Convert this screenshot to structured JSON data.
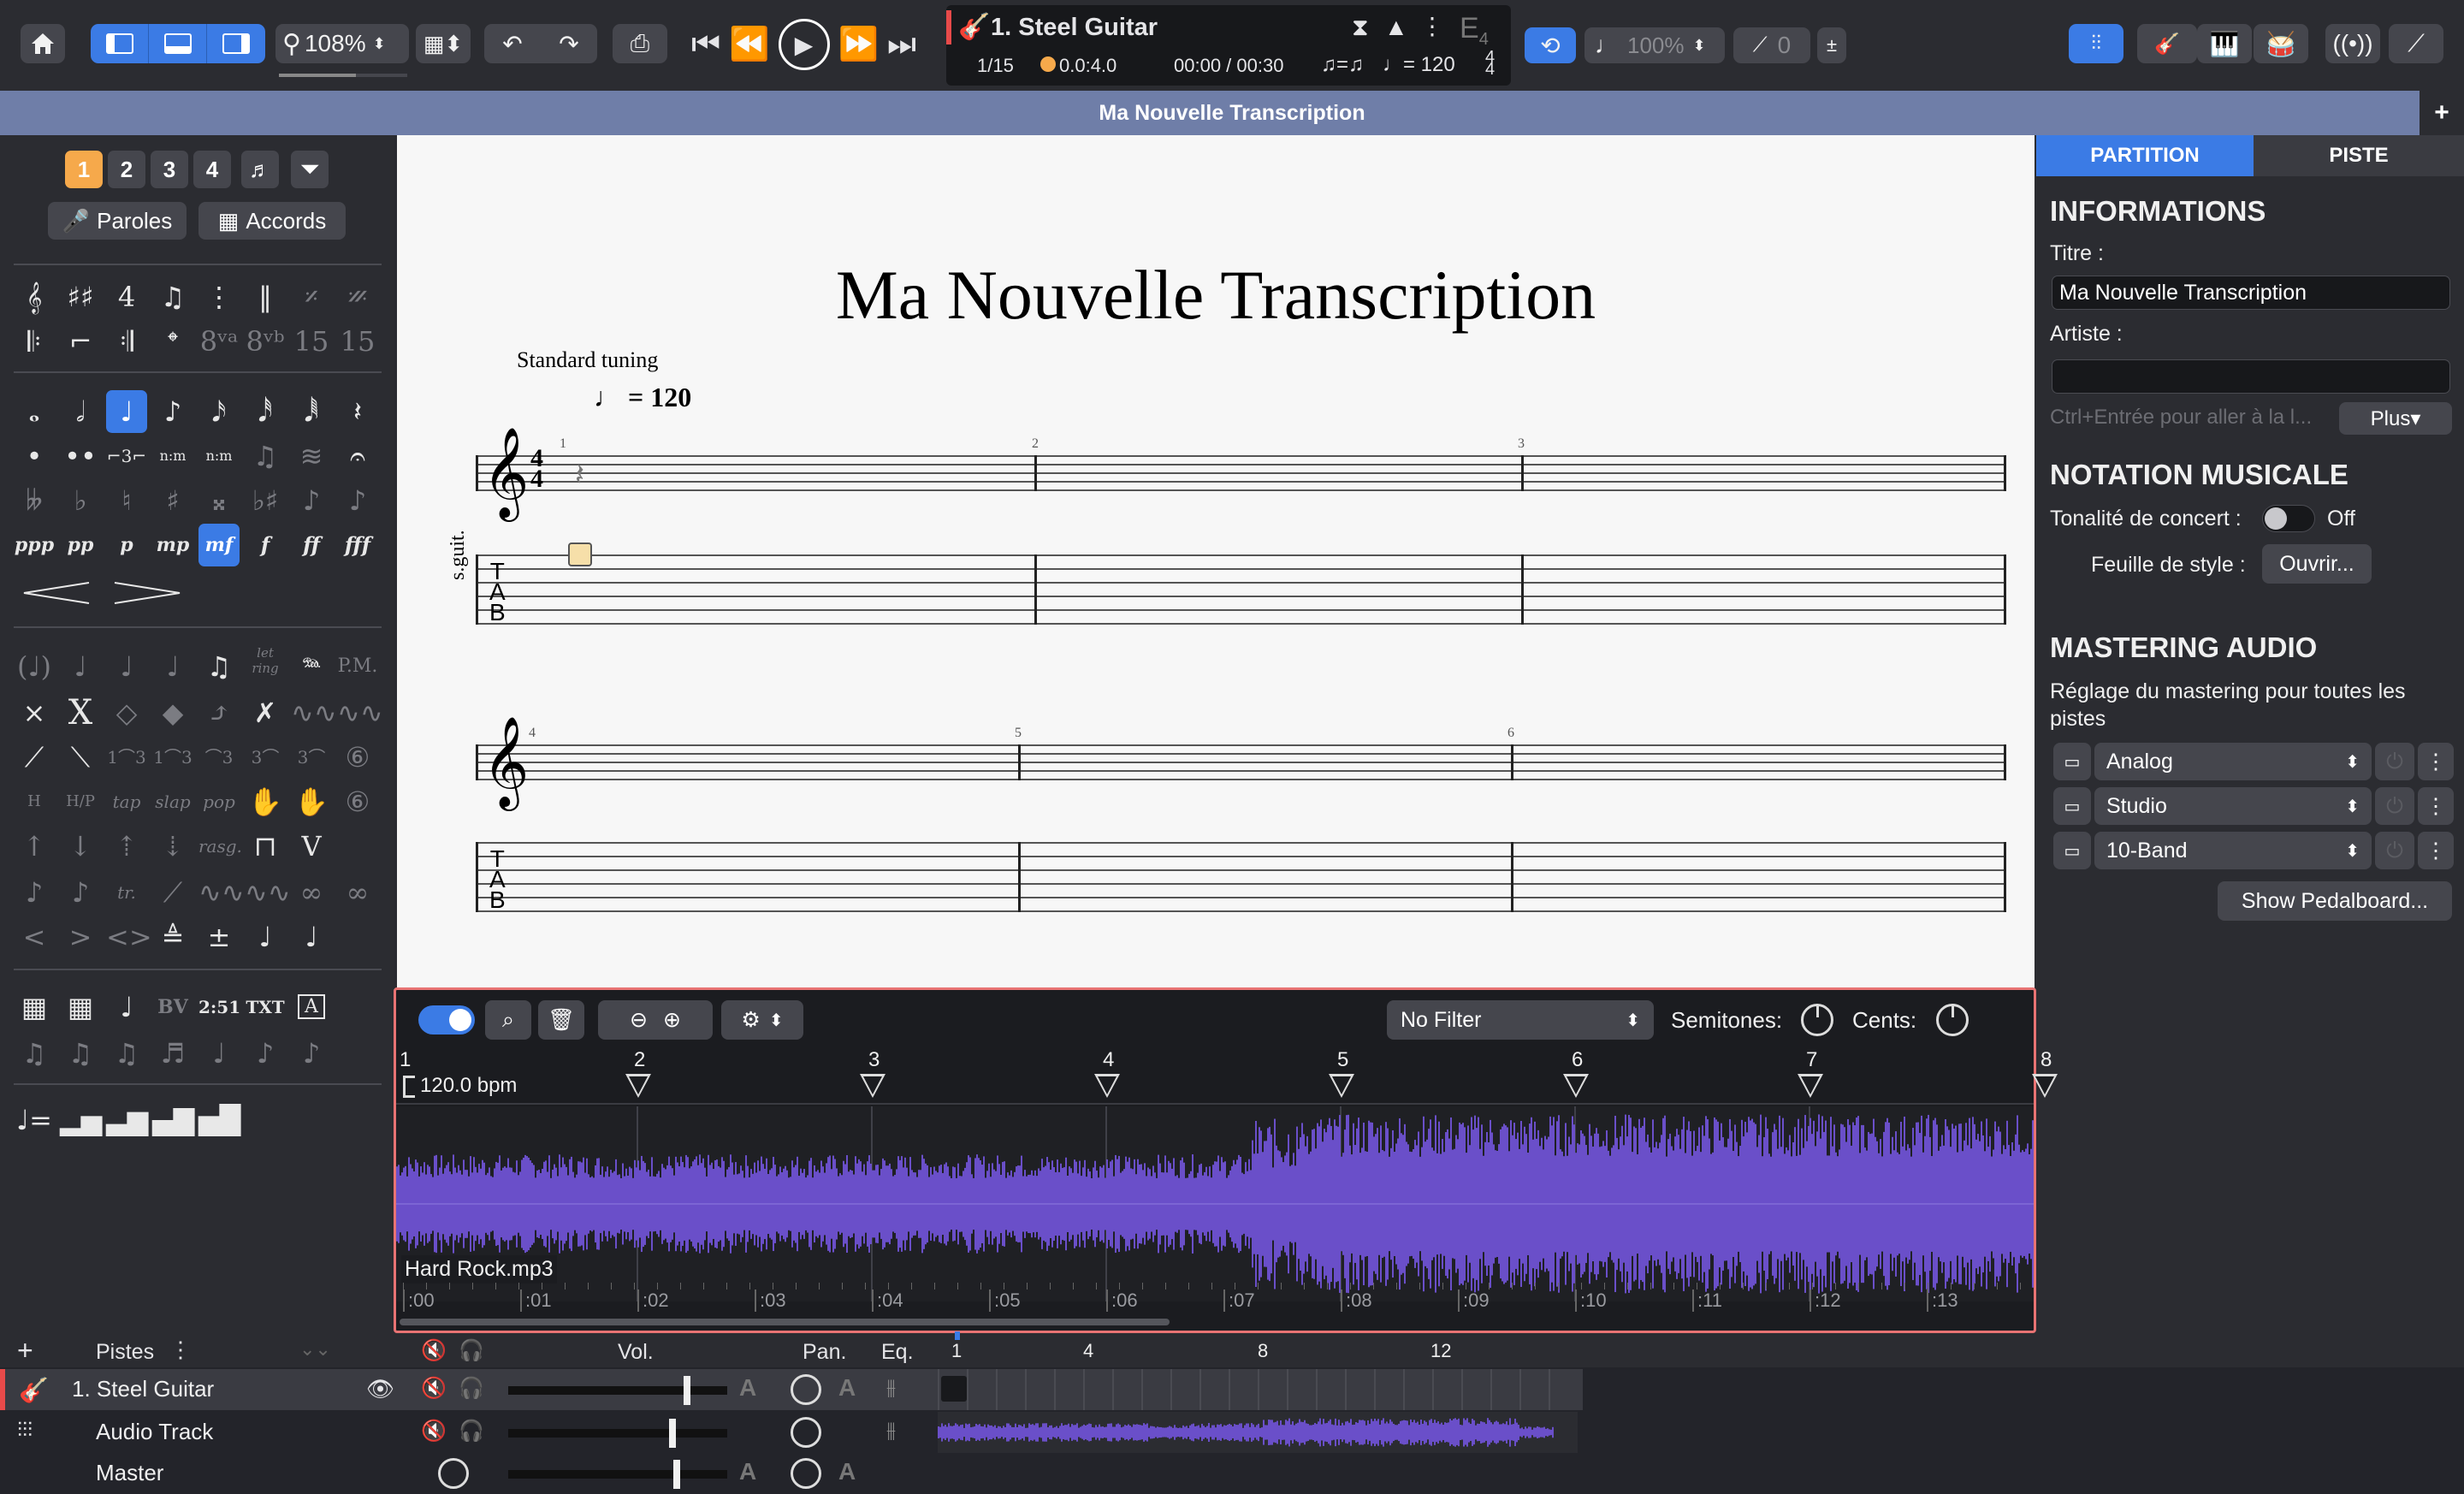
{
  "toolbar": {
    "zoom": "108%",
    "track_title": "1. Steel Guitar",
    "tuning_note": "E",
    "tuning_octave": "4",
    "bar_position": "1/15",
    "beat_position": "0.0:4.0",
    "time": "00:00 / 00:30",
    "swing_glyph": "♫=♫",
    "tempo": "♩= 120",
    "speed": "100%",
    "count": "0"
  },
  "document_title": "Ma Nouvelle Transcription",
  "left_panel": {
    "voices": [
      "1",
      "2",
      "3",
      "4"
    ],
    "lyrics_label": "Paroles",
    "chords_label": "Accords",
    "dynamics": [
      "ppp",
      "pp",
      "p",
      "mp",
      "mf",
      "f",
      "ff",
      "fff"
    ],
    "misc_labels": {
      "let_ring": "let ring",
      "pm": "P.M.",
      "tap": "tap",
      "slap": "slap",
      "pop": "pop",
      "rasg": "rasg.",
      "bv": "BV",
      "time": "2:51",
      "txt": "TXT",
      "a": "A"
    }
  },
  "score": {
    "title": "Ma Nouvelle Transcription",
    "tuning": "Standard tuning",
    "tempo_value": "= 120",
    "instrument_label": "s.guit.",
    "measures_row1": [
      "1",
      "2",
      "3"
    ],
    "measures_row2": [
      "4",
      "5",
      "6"
    ],
    "tab_letters": [
      "T",
      "A",
      "B"
    ]
  },
  "right_panel": {
    "tabs": [
      "PARTITION",
      "PISTE"
    ],
    "info_heading": "INFORMATIONS",
    "title_label": "Titre :",
    "title_value": "Ma Nouvelle Transcription",
    "artist_label": "Artiste :",
    "artist_value": "",
    "hint": "Ctrl+Entrée pour aller à la l...",
    "more_button": "Plus▾",
    "notation_heading": "NOTATION MUSICALE",
    "concert_pitch_label": "Tonalité de concert :",
    "concert_pitch_value": "Off",
    "stylesheet_label": "Feuille de style :",
    "stylesheet_button": "Ouvrir...",
    "mastering_heading": "MASTERING AUDIO",
    "mastering_desc": "Réglage du mastering pour toutes les pistes",
    "mastering_items": [
      "Analog",
      "Studio",
      "10-Band"
    ],
    "pedalboard_button": "Show Pedalboard..."
  },
  "audio_panel": {
    "filter": "No Filter",
    "semitones_label": "Semitones:",
    "cents_label": "Cents:",
    "bpm": "120.0 bpm",
    "bar_numbers": [
      "1",
      "2",
      "3",
      "4",
      "5",
      "6",
      "7",
      "8"
    ],
    "file_name": "Hard Rock.mp3",
    "time_ticks": [
      ":00",
      ":01",
      ":02",
      ":03",
      ":04",
      ":05",
      ":06",
      ":07",
      ":08",
      ":09",
      ":10",
      ":11",
      ":12",
      ":13"
    ]
  },
  "tracks": {
    "header_label": "Pistes",
    "vol_label": "Vol.",
    "pan_label": "Pan.",
    "eq_label": "Eq.",
    "timeline_numbers": [
      "1",
      "4",
      "8",
      "12"
    ],
    "rows": [
      {
        "name": "1. Steel Guitar",
        "volume": 0.82
      },
      {
        "name": "Audio Track",
        "volume": 0.75
      },
      {
        "name": "Master",
        "volume": 0.77
      }
    ],
    "auto_label": "A"
  },
  "colors": {
    "accent": "#3b7be5",
    "voice_active": "#f6a94b",
    "waveform": "#6a4fc9",
    "highlight_border": "#e87373"
  }
}
